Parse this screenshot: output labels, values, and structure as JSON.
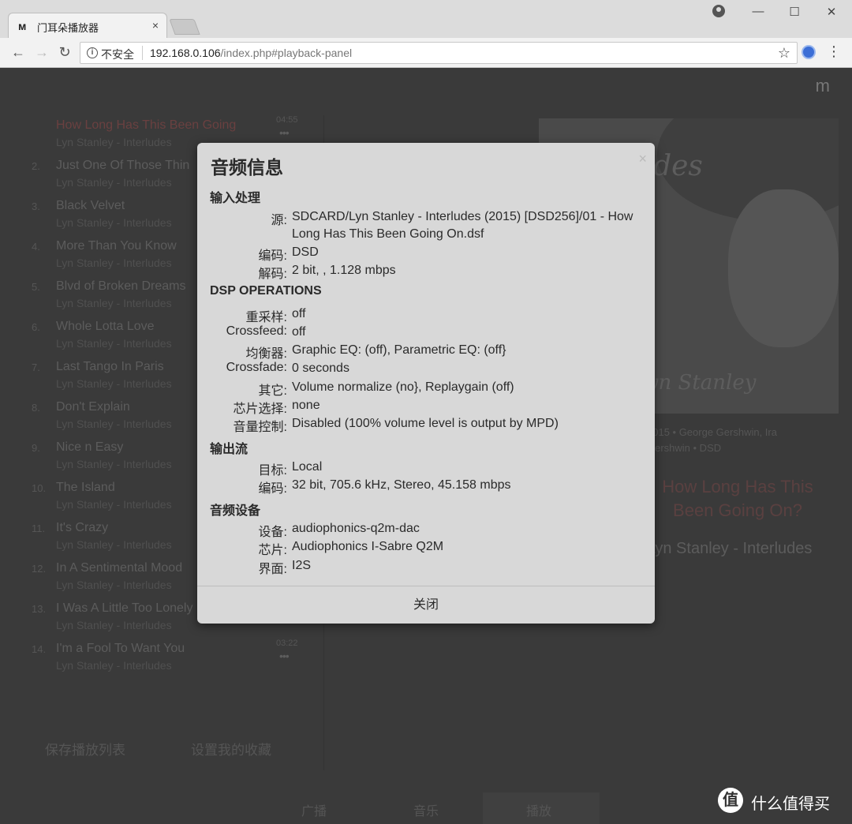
{
  "browser": {
    "tab_title": "门耳朵播放器",
    "tab_close": "×",
    "insecure_label": "不安全",
    "url_host": "192.168.0.106",
    "url_path": "/index.php#playback-panel",
    "win_minimize": "—",
    "win_maximize": "☐",
    "win_close": "✕",
    "menu": "⋮"
  },
  "app": {
    "brand": "m",
    "playlist": [
      {
        "num": "",
        "title": "How Long Has This Been Going",
        "sub": "Lyn Stanley - Interludes",
        "time": "04:55",
        "more": "•••"
      },
      {
        "num": "2.",
        "title": "Just One Of Those Thin",
        "sub": "Lyn Stanley - Interludes",
        "time": "",
        "more": ""
      },
      {
        "num": "3.",
        "title": "Black Velvet",
        "sub": "Lyn Stanley - Interludes",
        "time": "",
        "more": ""
      },
      {
        "num": "4.",
        "title": "More Than You Know",
        "sub": "Lyn Stanley - Interludes",
        "time": "",
        "more": ""
      },
      {
        "num": "5.",
        "title": "Blvd of Broken Dreams",
        "sub": "Lyn Stanley - Interludes",
        "time": "",
        "more": ""
      },
      {
        "num": "6.",
        "title": "Whole Lotta Love",
        "sub": "Lyn Stanley - Interludes",
        "time": "",
        "more": ""
      },
      {
        "num": "7.",
        "title": "Last Tango In Paris",
        "sub": "Lyn Stanley - Interludes",
        "time": "",
        "more": ""
      },
      {
        "num": "8.",
        "title": "Don't Explain",
        "sub": "Lyn Stanley - Interludes",
        "time": "",
        "more": ""
      },
      {
        "num": "9.",
        "title": "Nice n Easy",
        "sub": "Lyn Stanley - Interludes",
        "time": "",
        "more": ""
      },
      {
        "num": "10.",
        "title": "The Island",
        "sub": "Lyn Stanley - Interludes",
        "time": "",
        "more": ""
      },
      {
        "num": "11.",
        "title": "It's Crazy",
        "sub": "Lyn Stanley - Interludes",
        "time": "",
        "more": ""
      },
      {
        "num": "12.",
        "title": "In A Sentimental Mood",
        "sub": "Lyn Stanley - Interludes",
        "time": "",
        "more": ""
      },
      {
        "num": "13.",
        "title": "I Was A Little Too Lonely",
        "sub": "Lyn Stanley - Interludes",
        "time": "",
        "more": "•••"
      },
      {
        "num": "14.",
        "title": "I'm a Fool To Want You",
        "sub": "Lyn Stanley - Interludes",
        "time": "03:22",
        "more": "•••"
      }
    ],
    "save_playlist": "保存播放列表",
    "set_favorites": "设置我的收藏",
    "bottom_tabs": [
      "广播",
      "音乐",
      "播放"
    ],
    "cover_script": "Interludes",
    "cover_sig": "Lyn Stanley",
    "np_meta_1": "2015 • George Gershwin, Ira",
    "np_meta_2": "Gershwin • DSD",
    "np_title": "How Long Has This Been Going On?",
    "np_artist": "Lyn Stanley - Interludes"
  },
  "modal": {
    "title": "音频信息",
    "close_x": "×",
    "sections": {
      "input": {
        "title": "输入处理",
        "rows": [
          {
            "label": "源:",
            "value": "SDCARD/Lyn Stanley - Interludes (2015) [DSD256]/01 - How Long Has This Been Going On.dsf"
          },
          {
            "label": "编码:",
            "value": "DSD"
          },
          {
            "label": "解码:",
            "value": "2 bit, , 1.128 mbps"
          }
        ]
      },
      "dsp": {
        "title": "DSP OPERATIONS",
        "rows": [
          {
            "label": "重采样:",
            "value": "off"
          },
          {
            "label": "Crossfeed:",
            "value": "off"
          },
          {
            "label": "均衡器:",
            "value": "Graphic EQ: (off), Parametric EQ: (off}"
          },
          {
            "label": "Crossfade:",
            "value": "0 seconds"
          },
          {
            "label": "其它:",
            "value": "Volume normalize (no}, Replaygain (off)"
          },
          {
            "label": "芯片选择:",
            "value": "none"
          },
          {
            "label": "音量控制:",
            "value": "Disabled (100% volume level is output by MPD)"
          }
        ]
      },
      "output": {
        "title": "输出流",
        "rows": [
          {
            "label": "目标:",
            "value": "Local"
          },
          {
            "label": "编码:",
            "value": "32 bit, 705.6 kHz, Stereo, 45.158 mbps"
          }
        ]
      },
      "device": {
        "title": "音频设备",
        "rows": [
          {
            "label": "设备:",
            "value": "audiophonics-q2m-dac"
          },
          {
            "label": "芯片:",
            "value": "Audiophonics I-Sabre Q2M"
          },
          {
            "label": "界面:",
            "value": "I2S"
          }
        ]
      }
    },
    "close_button": "关闭"
  },
  "watermark": {
    "logo": "值",
    "text": "什么值得买"
  }
}
